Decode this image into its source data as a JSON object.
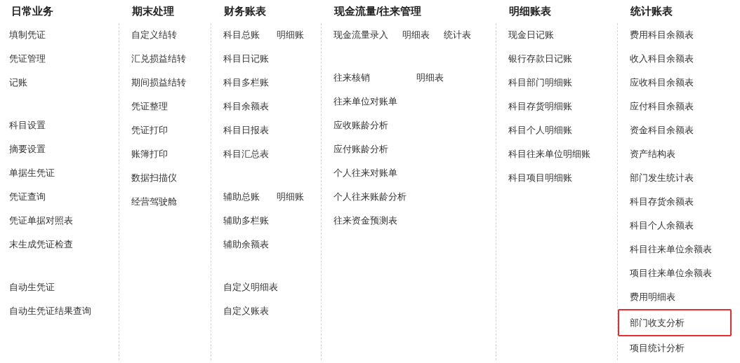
{
  "columns": [
    {
      "title": "日常业务",
      "groups": [
        {
          "rows": [
            [
              {
                "label": "填制凭证",
                "selected": false
              }
            ],
            [
              {
                "label": "凭证管理",
                "selected": false
              }
            ],
            [
              {
                "label": "记账",
                "selected": false
              }
            ]
          ]
        },
        {
          "rows": [
            [
              {
                "label": "科目设置",
                "selected": false
              }
            ],
            [
              {
                "label": "摘要设置",
                "selected": false
              }
            ],
            [
              {
                "label": "单据生凭证",
                "selected": false
              }
            ],
            [
              {
                "label": "凭证查询",
                "selected": false
              }
            ],
            [
              {
                "label": "凭证单据对照表",
                "selected": false
              }
            ],
            [
              {
                "label": "末生成凭证检查",
                "selected": false
              }
            ]
          ]
        },
        {
          "rows": [
            [
              {
                "label": "自动生凭证",
                "selected": false
              }
            ],
            [
              {
                "label": "自动生凭证结果查询",
                "selected": false
              }
            ]
          ]
        }
      ]
    },
    {
      "title": "期末处理",
      "groups": [
        {
          "rows": [
            [
              {
                "label": "自定义结转",
                "selected": false
              }
            ],
            [
              {
                "label": "汇兑损益结转",
                "selected": false
              }
            ],
            [
              {
                "label": "期间损益结转",
                "selected": false
              }
            ],
            [
              {
                "label": "凭证整理",
                "selected": false
              }
            ],
            [
              {
                "label": "凭证打印",
                "selected": false
              }
            ],
            [
              {
                "label": "账簿打印",
                "selected": false
              }
            ],
            [
              {
                "label": "数据扫描仪",
                "selected": false
              }
            ],
            [
              {
                "label": "经营驾驶舱",
                "selected": false
              }
            ]
          ]
        }
      ]
    },
    {
      "title": "财务账表",
      "groups": [
        {
          "rows": [
            [
              {
                "label": "科目总账",
                "selected": false
              },
              {
                "label": "明细账",
                "selected": false
              }
            ],
            [
              {
                "label": "科目日记账",
                "selected": false
              }
            ],
            [
              {
                "label": "科目多栏账",
                "selected": false
              }
            ],
            [
              {
                "label": "科目余额表",
                "selected": false
              }
            ],
            [
              {
                "label": "科目日报表",
                "selected": false
              }
            ],
            [
              {
                "label": "科目汇总表",
                "selected": false
              }
            ]
          ]
        },
        {
          "rows": [
            [
              {
                "label": "辅助总账",
                "selected": false
              },
              {
                "label": "明细账",
                "selected": false
              }
            ],
            [
              {
                "label": "辅助多栏账",
                "selected": false
              }
            ],
            [
              {
                "label": "辅助余额表",
                "selected": false
              }
            ]
          ]
        },
        {
          "rows": [
            [
              {
                "label": "自定义明细表",
                "selected": false
              }
            ],
            [
              {
                "label": "自定义账表",
                "selected": false
              }
            ]
          ]
        }
      ]
    },
    {
      "title": "现金流量/往来管理",
      "groups": [
        {
          "rows": [
            [
              {
                "label": "现金流量录入",
                "selected": false
              },
              {
                "label": "明细表",
                "selected": false
              },
              {
                "label": "统计表",
                "selected": false
              }
            ]
          ]
        },
        {
          "rows": [
            [
              {
                "label": "往来核销",
                "selected": false
              },
              {
                "label": "明细表",
                "selected": false
              }
            ],
            [
              {
                "label": "往来单位对账单",
                "selected": false
              }
            ],
            [
              {
                "label": "应收账龄分析",
                "selected": false
              }
            ],
            [
              {
                "label": "应付账龄分析",
                "selected": false
              }
            ],
            [
              {
                "label": "个人往来对账单",
                "selected": false
              }
            ],
            [
              {
                "label": "个人往来账龄分析",
                "selected": false
              }
            ],
            [
              {
                "label": "往来资金预测表",
                "selected": false
              }
            ]
          ]
        }
      ]
    },
    {
      "title": "明细账表",
      "groups": [
        {
          "rows": [
            [
              {
                "label": "现金日记账",
                "selected": false
              }
            ],
            [
              {
                "label": "银行存款日记账",
                "selected": false
              }
            ],
            [
              {
                "label": "科目部门明细账",
                "selected": false
              }
            ],
            [
              {
                "label": "科目存货明细账",
                "selected": false
              }
            ],
            [
              {
                "label": "科目个人明细账",
                "selected": false
              }
            ],
            [
              {
                "label": "科目往来单位明细账",
                "selected": false
              }
            ],
            [
              {
                "label": "科目项目明细账",
                "selected": false
              }
            ]
          ]
        }
      ]
    },
    {
      "title": "统计账表",
      "groups": [
        {
          "rows": [
            [
              {
                "label": "费用科目余额表",
                "selected": false
              }
            ],
            [
              {
                "label": "收入科目余额表",
                "selected": false
              }
            ],
            [
              {
                "label": "应收科目余额表",
                "selected": false
              }
            ],
            [
              {
                "label": "应付科目余额表",
                "selected": false
              }
            ],
            [
              {
                "label": "资金科目余额表",
                "selected": false
              }
            ],
            [
              {
                "label": "资产结构表",
                "selected": false
              }
            ],
            [
              {
                "label": "部门发生统计表",
                "selected": false
              }
            ],
            [
              {
                "label": "科目存货余额表",
                "selected": false
              }
            ],
            [
              {
                "label": "科目个人余额表",
                "selected": false
              }
            ],
            [
              {
                "label": "科目往来单位余额表",
                "selected": false
              }
            ],
            [
              {
                "label": "项目往来单位余额表",
                "selected": false
              }
            ],
            [
              {
                "label": "费用明细表",
                "selected": false
              }
            ],
            [
              {
                "label": "部门收支分析",
                "selected": true
              }
            ],
            [
              {
                "label": "项目统计分析",
                "selected": false
              }
            ]
          ]
        }
      ]
    }
  ]
}
